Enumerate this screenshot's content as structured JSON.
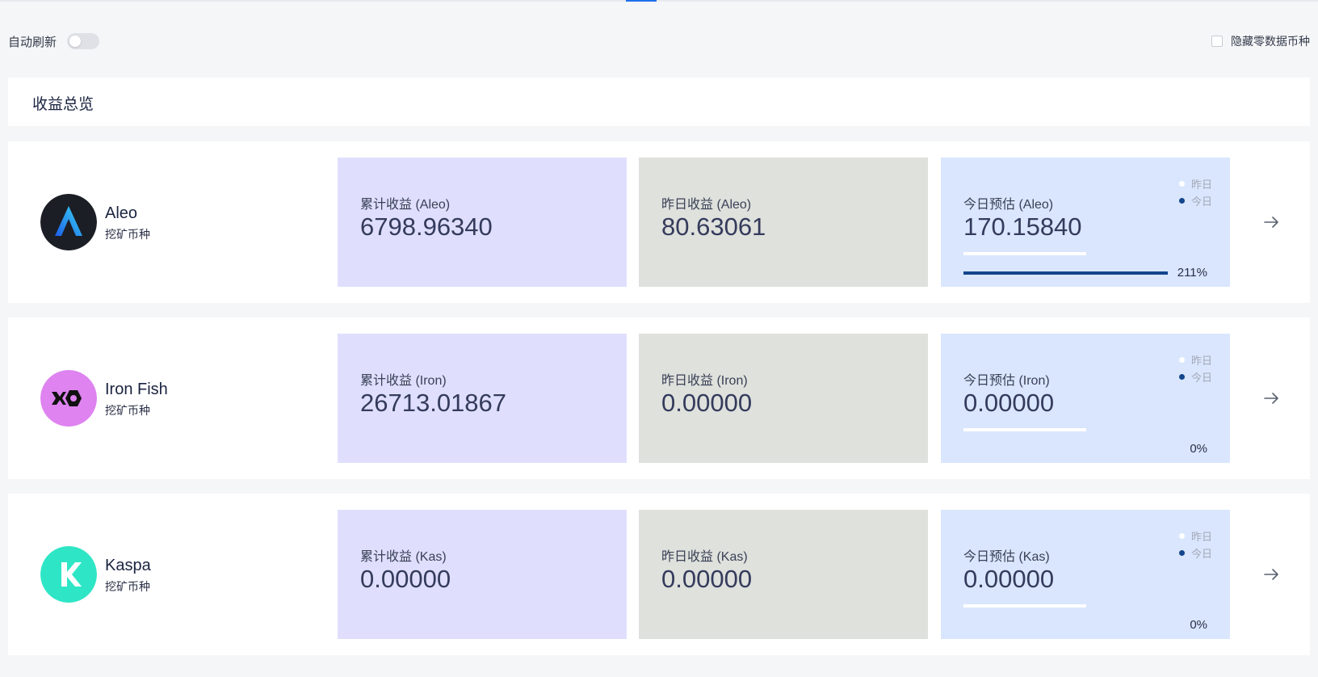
{
  "toolbar": {
    "auto_refresh_label": "自动刷新",
    "auto_refresh_enabled": false,
    "hide_zero_label": "隐藏零数据币种",
    "hide_zero_checked": false
  },
  "overview": {
    "title": "收益总览"
  },
  "legend": {
    "yesterday": "昨日",
    "today": "今日"
  },
  "colors": {
    "accent": "#13458c",
    "cumulative_bg": "#dfdffd",
    "yesterday_bg": "#dee1dc",
    "today_bg": "#d9e6fd"
  },
  "coins": [
    {
      "name": "Aleo",
      "subtitle": "挖矿币种",
      "icon": "aleo-logo-icon",
      "cumulative_label": "累计收益 (Aleo)",
      "cumulative_value": "6798.96340",
      "yesterday_label": "昨日收益 (Aleo)",
      "yesterday_value": "80.63061",
      "today_label": "今日预估 (Aleo)",
      "today_value": "170.15840",
      "percent_text": "211%",
      "percent": 211
    },
    {
      "name": "Iron Fish",
      "subtitle": "挖矿币种",
      "icon": "iron-fish-logo-icon",
      "cumulative_label": "累计收益 (Iron)",
      "cumulative_value": "26713.01867",
      "yesterday_label": "昨日收益 (Iron)",
      "yesterday_value": "0.00000",
      "today_label": "今日预估 (Iron)",
      "today_value": "0.00000",
      "percent_text": "0%",
      "percent": 0
    },
    {
      "name": "Kaspa",
      "subtitle": "挖矿币种",
      "icon": "kaspa-logo-icon",
      "cumulative_label": "累计收益 (Kas)",
      "cumulative_value": "0.00000",
      "yesterday_label": "昨日收益 (Kas)",
      "yesterday_value": "0.00000",
      "today_label": "今日预估 (Kas)",
      "today_value": "0.00000",
      "percent_text": "0%",
      "percent": 0
    }
  ]
}
